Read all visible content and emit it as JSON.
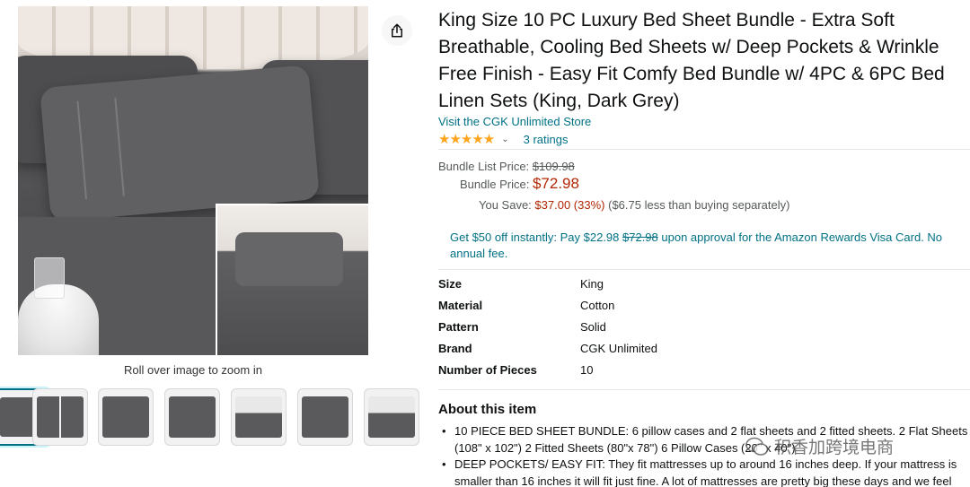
{
  "product": {
    "title": "King Size 10 PC Luxury Bed Sheet Bundle - Extra Soft Breathable, Cooling Bed Sheets w/ Deep Pockets & Wrinkle Free Finish - Easy Fit Comfy Bed Bundle w/ 4PC & 6PC Bed Linen Sets (King, Dark Grey)",
    "store_link": "Visit the CGK Unlimited Store",
    "rating": 5,
    "ratings_count": "3 ratings"
  },
  "gallery": {
    "zoom_hint": "Roll over image to zoom in",
    "thumbnails_count": 7,
    "active_thumbnail": 1
  },
  "pricing": {
    "list_price_label": "Bundle List Price:",
    "list_price": "$109.98",
    "bundle_price_label": "Bundle Price:",
    "bundle_price": "$72.98",
    "you_save_label": "You Save:",
    "you_save": "$37.00 (33%)",
    "you_save_extra": "($6.75 less than buying separately)"
  },
  "promo": {
    "text_before": "Get $50 off instantly: Pay $22.98 ",
    "strike_price": "$72.98",
    "text_after": " upon approval for the Amazon Rewards Visa Card. No annual fee."
  },
  "specs": [
    {
      "label": "Size",
      "value": "King"
    },
    {
      "label": "Material",
      "value": "Cotton"
    },
    {
      "label": "Pattern",
      "value": "Solid"
    },
    {
      "label": "Brand",
      "value": "CGK Unlimited"
    },
    {
      "label": "Number of Pieces",
      "value": "10"
    }
  ],
  "about": {
    "heading": "About this item",
    "bullets": [
      "10 PIECE BED SHEET BUNDLE: 6 pillow cases and 2 flat sheets and 2 fitted sheets. 2 Flat Sheets (108\" x 102\") 2 Fitted Sheets (80\"x 78\") 6 Pillow Cases (20\" x 40\")",
      "DEEP POCKETS/ EASY FIT: They fit mattresses up to around 16 inches deep. If your mattress is smaller than 16 inches it will fit just fine. A lot of mattresses are pretty big these days and we feel"
    ]
  },
  "watermark": {
    "text": "积香加跨境电商"
  },
  "icons": {
    "share": "share-icon",
    "chevron": "chevron-down-icon"
  },
  "colors": {
    "link": "#007185",
    "price_red": "#b12704",
    "star": "#ffa41c"
  }
}
